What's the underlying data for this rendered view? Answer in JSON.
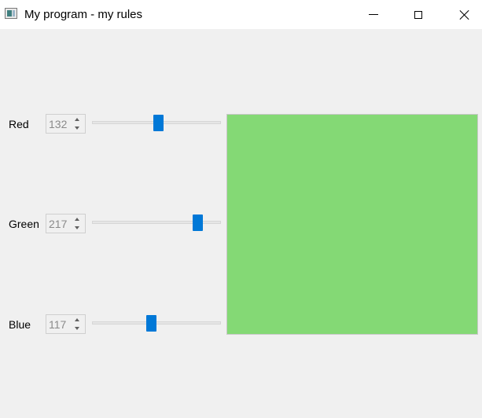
{
  "window": {
    "title": "My program - my rules",
    "icon": "app-window-icon",
    "controls": [
      "minimize-icon",
      "maximize-icon",
      "close-icon"
    ]
  },
  "channels": [
    {
      "label": "Red",
      "value": "132",
      "level": 132,
      "max": 255
    },
    {
      "label": "Green",
      "value": "217",
      "level": 217,
      "max": 255
    },
    {
      "label": "Blue",
      "value": "117",
      "level": 117,
      "max": 255
    }
  ],
  "preview": {
    "color": "#84d975"
  },
  "colors": {
    "background": "#f0f0f0",
    "titlebar": "#ffffff",
    "slider_handle": "#0078d7",
    "spin_text": "#8a8a8a"
  }
}
